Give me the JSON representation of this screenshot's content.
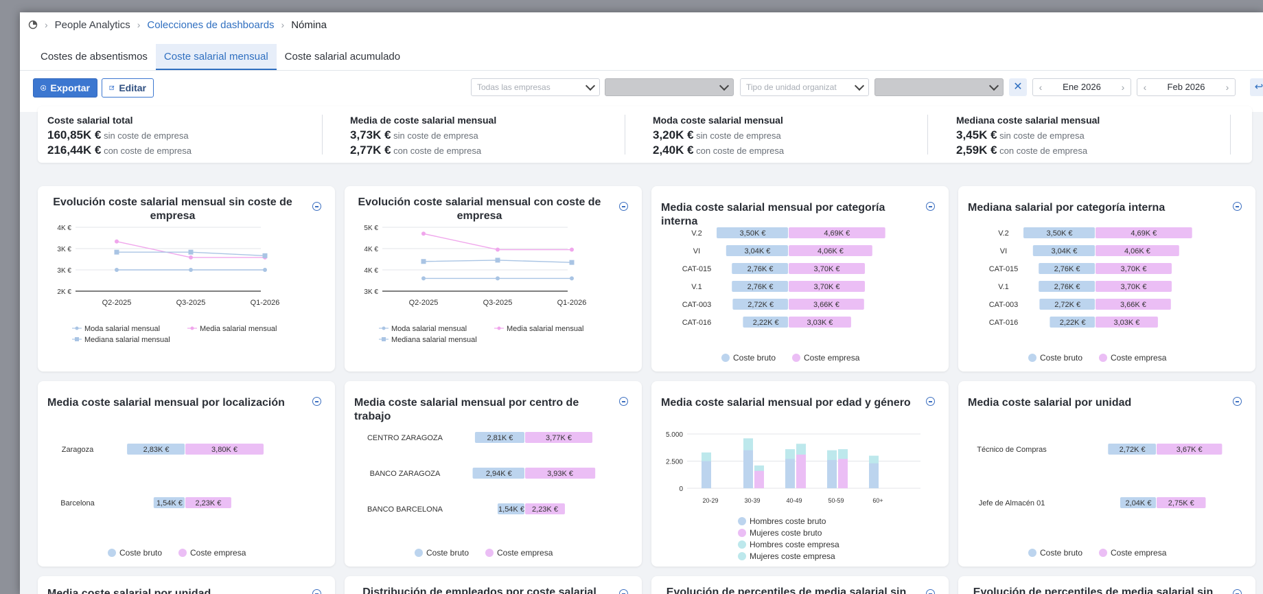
{
  "breadcrumb": {
    "root": "People Analytics",
    "collection": "Colecciones de dashboards",
    "current": "Nómina"
  },
  "tabs": [
    "Costes de absentismos",
    "Coste salarial mensual",
    "Coste salarial acumulado"
  ],
  "toolbar": {
    "export_label": "Exportar",
    "edit_label": "Editar",
    "company_placeholder": "Todas las empresas",
    "unit_type_placeholder": "Tipo de unidad organizat",
    "date_from": "Ene 2026",
    "date_to": "Feb 2026"
  },
  "kpis": [
    {
      "title": "Coste salarial total",
      "v1": "160,85K €",
      "l1": "sin coste de empresa",
      "v2": "216,44K €",
      "l2": "con coste de empresa"
    },
    {
      "title": "Media de coste salarial mensual",
      "v1": "3,73K €",
      "l1": "sin coste de empresa",
      "v2": "2,77K €",
      "l2": "con coste de empresa"
    },
    {
      "title": "Moda coste salarial mensual",
      "v1": "3,20K €",
      "l1": "sin coste de empresa",
      "v2": "2,40K €",
      "l2": "con coste de empresa"
    },
    {
      "title": "Mediana coste salarial mensual",
      "v1": "3,45K €",
      "l1": "sin coste de empresa",
      "v2": "2,59K €",
      "l2": "con coste de empresa"
    }
  ],
  "colors": {
    "brand": "#3c77d0",
    "bruto": "#bcd4ee",
    "empresa": "#ebbef5",
    "empresa_line": "#f0a6ec",
    "teal": "#bde8ec"
  },
  "card_titles": {
    "c1a": "Evolución coste salarial mensual sin coste de",
    "c1b": "empresa",
    "c2a": "Evolución coste salarial mensual con coste de",
    "c2b": "empresa",
    "c3": "Media coste salarial mensual por categoría interna",
    "c4": "Mediana salarial por categoría interna",
    "c5": "Media coste salarial mensual por localización",
    "c6": "Media coste salarial mensual por centro de trabajo",
    "c7": "Media coste salarial mensual por edad y género",
    "c8": "Media coste salarial por unidad",
    "c9": "Media coste salarial por unidad",
    "c10": "Distribución de empleados por coste salarial",
    "c11": "Evolución de percentiles de media salarial sin coste",
    "c12": "Evolución de percentiles de media salarial sin coste"
  },
  "legends": {
    "moda": "Moda salarial mensual",
    "media": "Media salarial mensual",
    "mediana": "Mediana salarial mensual",
    "bruto": "Coste bruto",
    "empresa": "Coste empresa"
  },
  "chart_data": [
    {
      "type": "line",
      "title": "Evolución coste salarial mensual sin coste de empresa",
      "x": [
        "Q2-2025",
        "Q3-2025",
        "Q1-2026"
      ],
      "yticks": [
        "4K €",
        "3K €",
        "3K €",
        "2K €"
      ],
      "ylim": [
        2200,
        4000
      ],
      "series": [
        {
          "name": "Moda salarial mensual",
          "values": [
            2800,
            2800,
            2800
          ]
        },
        {
          "name": "Media salarial mensual",
          "values": [
            3600,
            3150,
            3150
          ]
        },
        {
          "name": "Mediana salarial mensual",
          "values": [
            3300,
            3300,
            3200
          ]
        }
      ]
    },
    {
      "type": "line",
      "title": "Evolución coste salarial mensual con coste de empresa",
      "x": [
        "Q2-2025",
        "Q3-2025",
        "Q1-2026"
      ],
      "yticks": [
        "5K €",
        "4K €",
        "4K €",
        "3K €"
      ],
      "ylim": [
        3000,
        5000
      ],
      "series": [
        {
          "name": "Moda salarial mensual",
          "values": [
            3400,
            3400,
            3400
          ]
        },
        {
          "name": "Media salarial mensual",
          "values": [
            4800,
            4300,
            4300
          ]
        },
        {
          "name": "Mediana salarial mensual",
          "values": [
            3930,
            3970,
            3900
          ]
        }
      ]
    },
    {
      "type": "bar",
      "title": "Media coste salarial mensual por categoría interna",
      "categories": [
        "V.2",
        "VI",
        "CAT-015",
        "V.1",
        "CAT-003",
        "CAT-016"
      ],
      "series": [
        {
          "name": "Coste bruto",
          "values": [
            3.5,
            3.04,
            2.76,
            2.76,
            2.72,
            2.22
          ],
          "labels": [
            "3,50K €",
            "3,04K €",
            "2,76K €",
            "2,76K €",
            "2,72K €",
            "2,22K €"
          ]
        },
        {
          "name": "Coste empresa",
          "values": [
            4.69,
            4.06,
            3.7,
            3.7,
            3.66,
            3.03
          ],
          "labels": [
            "4,69K €",
            "4,06K €",
            "3,70K €",
            "3,70K €",
            "3,66K €",
            "3,03K €"
          ]
        }
      ]
    },
    {
      "type": "bar",
      "title": "Mediana salarial por categoría interna",
      "categories": [
        "V.2",
        "VI",
        "CAT-015",
        "V.1",
        "CAT-003",
        "CAT-016"
      ],
      "series": [
        {
          "name": "Coste bruto",
          "values": [
            3.5,
            3.04,
            2.76,
            2.76,
            2.72,
            2.22
          ],
          "labels": [
            "3,50K €",
            "3,04K €",
            "2,76K €",
            "2,76K €",
            "2,72K €",
            "2,22K €"
          ]
        },
        {
          "name": "Coste empresa",
          "values": [
            4.69,
            4.06,
            3.7,
            3.7,
            3.66,
            3.03
          ],
          "labels": [
            "4,69K €",
            "4,06K €",
            "3,70K €",
            "3,70K €",
            "3,66K €",
            "3,03K €"
          ]
        }
      ]
    },
    {
      "type": "bar",
      "title": "Media coste salarial mensual por localización",
      "categories": [
        "Zaragoza",
        "Barcelona"
      ],
      "series": [
        {
          "name": "Coste bruto",
          "values": [
            2.83,
            1.54
          ],
          "labels": [
            "2,83K €",
            "1,54K €"
          ]
        },
        {
          "name": "Coste empresa",
          "values": [
            3.8,
            2.23
          ],
          "labels": [
            "3,80K €",
            "2,23K €"
          ]
        }
      ]
    },
    {
      "type": "bar",
      "title": "Media coste salarial mensual por centro de trabajo",
      "categories": [
        "CENTRO ZARAGOZA",
        "BANCO ZARAGOZA",
        "BANCO BARCELONA"
      ],
      "series": [
        {
          "name": "Coste bruto",
          "values": [
            2.81,
            2.94,
            1.54
          ],
          "labels": [
            "2,81K €",
            "2,94K €",
            "1,54K €"
          ]
        },
        {
          "name": "Coste empresa",
          "values": [
            3.77,
            3.93,
            2.23
          ],
          "labels": [
            "3,77K €",
            "3,93K €",
            "2,23K €"
          ]
        }
      ]
    },
    {
      "type": "bar",
      "title": "Media coste salarial mensual por edad y género",
      "categories": [
        "20-29",
        "30-39",
        "40-49",
        "50-59",
        "60+"
      ],
      "yticks": [
        "5.000",
        "2.500",
        "0"
      ],
      "ylim": [
        0,
        5000
      ],
      "series": [
        {
          "name": "Hombres coste bruto",
          "values": [
            2500,
            3500,
            2700,
            2600,
            2300
          ]
        },
        {
          "name": "Mujeres coste bruto",
          "values": [
            0,
            1600,
            3100,
            2700,
            0
          ]
        },
        {
          "name": "Hombres coste empresa",
          "values": [
            3300,
            4600,
            3600,
            3500,
            3000
          ]
        },
        {
          "name": "Mujeres coste empresa",
          "values": [
            0,
            2100,
            4100,
            3600,
            0
          ]
        }
      ]
    },
    {
      "type": "bar",
      "title": "Media coste salarial por unidad",
      "categories": [
        "Técnico de Compras",
        "Jefe de Almacén 01"
      ],
      "series": [
        {
          "name": "Coste bruto",
          "values": [
            2.72,
            2.04
          ],
          "labels": [
            "2,72K €",
            "2,04K €"
          ]
        },
        {
          "name": "Coste empresa",
          "values": [
            3.67,
            2.75
          ],
          "labels": [
            "3,67K €",
            "2,75K €"
          ]
        }
      ]
    }
  ]
}
